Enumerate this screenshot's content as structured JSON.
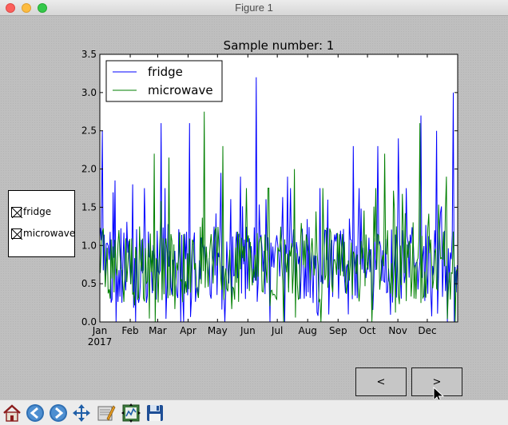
{
  "window": {
    "title": "Figure 1"
  },
  "chart_data": {
    "type": "line",
    "title": "Sample number: 1",
    "xlabel": "",
    "ylabel": "",
    "x_start": "2017-01-01",
    "x_end": "2017-12-31",
    "x_tick_labels": [
      "Jan",
      "Feb",
      "Mar",
      "Apr",
      "May",
      "Jun",
      "Jul",
      "Aug",
      "Sep",
      "Oct",
      "Nov",
      "Dec"
    ],
    "x_tick_dates": [
      "2017-01-01",
      "2017-02-01",
      "2017-03-01",
      "2017-04-01",
      "2017-05-01",
      "2017-06-01",
      "2017-07-01",
      "2017-08-01",
      "2017-09-01",
      "2017-10-01",
      "2017-11-01",
      "2017-12-01"
    ],
    "x_year_label": "2017",
    "ylim": [
      0.0,
      3.5
    ],
    "y_ticks": [
      "0.0",
      "0.5",
      "1.0",
      "1.5",
      "2.0",
      "2.5",
      "3.0",
      "3.5"
    ],
    "grid": false,
    "legend_position": "top-left",
    "series": [
      {
        "name": "fridge",
        "color": "#0000ff",
        "peaks": [
          {
            "date": "2017-01-03",
            "value": 2.5
          },
          {
            "date": "2017-01-16",
            "value": 1.85
          },
          {
            "date": "2017-02-03",
            "value": 1.8
          },
          {
            "date": "2017-03-04",
            "value": 2.6
          },
          {
            "date": "2017-04-02",
            "value": 2.6
          },
          {
            "date": "2017-05-04",
            "value": 1.95
          },
          {
            "date": "2017-05-24",
            "value": 1.9
          },
          {
            "date": "2017-06-09",
            "value": 3.2
          },
          {
            "date": "2017-07-11",
            "value": 1.9
          },
          {
            "date": "2017-08-21",
            "value": 1.6
          },
          {
            "date": "2017-09-16",
            "value": 2.3
          },
          {
            "date": "2017-10-11",
            "value": 2.3
          },
          {
            "date": "2017-11-01",
            "value": 2.4
          },
          {
            "date": "2017-11-24",
            "value": 2.7
          },
          {
            "date": "2017-12-10",
            "value": 2.5
          },
          {
            "date": "2017-12-27",
            "value": 3.0
          }
        ]
      },
      {
        "name": "microwave",
        "color": "#007f00",
        "peaks": [
          {
            "date": "2017-02-25",
            "value": 2.2
          },
          {
            "date": "2017-03-12",
            "value": 2.15
          },
          {
            "date": "2017-04-17",
            "value": 2.75
          },
          {
            "date": "2017-05-06",
            "value": 2.3
          },
          {
            "date": "2017-06-22",
            "value": 1.75
          },
          {
            "date": "2017-07-18",
            "value": 2.0
          },
          {
            "date": "2017-10-18",
            "value": 2.2
          },
          {
            "date": "2017-11-23",
            "value": 2.6
          },
          {
            "date": "2017-12-20",
            "value": 1.9
          }
        ]
      }
    ]
  },
  "checkbuttons": [
    {
      "label": "fridge",
      "checked": true
    },
    {
      "label": "microwave",
      "checked": true
    }
  ],
  "buttons": {
    "prev_label": "<",
    "next_label": ">"
  },
  "toolbar": {
    "icons": [
      "home-icon",
      "back-arrow-icon",
      "forward-arrow-icon",
      "pan-icon",
      "zoom-icon",
      "subplots-icon",
      "save-icon"
    ]
  }
}
